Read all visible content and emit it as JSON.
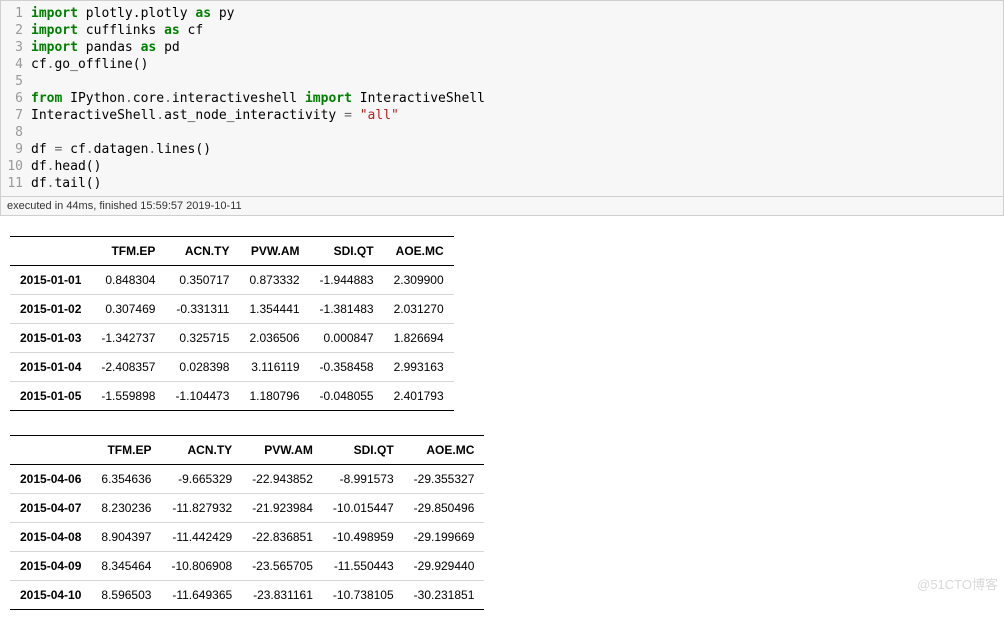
{
  "code": {
    "lines": [
      {
        "n": "1",
        "tokens": [
          [
            "kw",
            "import"
          ],
          [
            "nm",
            " plotly.plotly "
          ],
          [
            "kw",
            "as"
          ],
          [
            "nm",
            " py"
          ]
        ]
      },
      {
        "n": "2",
        "tokens": [
          [
            "kw",
            "import"
          ],
          [
            "nm",
            " cufflinks "
          ],
          [
            "kw",
            "as"
          ],
          [
            "nm",
            " cf"
          ]
        ]
      },
      {
        "n": "3",
        "tokens": [
          [
            "kw",
            "import"
          ],
          [
            "nm",
            " pandas "
          ],
          [
            "kw",
            "as"
          ],
          [
            "nm",
            " pd"
          ]
        ]
      },
      {
        "n": "4",
        "tokens": [
          [
            "nm",
            "cf"
          ],
          [
            "op",
            "."
          ],
          [
            "nm",
            "go_offline()"
          ]
        ]
      },
      {
        "n": "5",
        "tokens": [
          [
            "nm",
            ""
          ]
        ]
      },
      {
        "n": "6",
        "tokens": [
          [
            "kw",
            "from"
          ],
          [
            "nm",
            " IPython"
          ],
          [
            "op",
            "."
          ],
          [
            "nm",
            "core"
          ],
          [
            "op",
            "."
          ],
          [
            "nm",
            "interactiveshell "
          ],
          [
            "kw",
            "import"
          ],
          [
            "nm",
            " InteractiveShell"
          ]
        ]
      },
      {
        "n": "7",
        "tokens": [
          [
            "nm",
            "InteractiveShell"
          ],
          [
            "op",
            "."
          ],
          [
            "nm",
            "ast_node_interactivity "
          ],
          [
            "op",
            "="
          ],
          [
            "nm",
            " "
          ],
          [
            "str",
            "\"all\""
          ]
        ]
      },
      {
        "n": "8",
        "tokens": [
          [
            "nm",
            ""
          ]
        ]
      },
      {
        "n": "9",
        "tokens": [
          [
            "nm",
            "df "
          ],
          [
            "op",
            "="
          ],
          [
            "nm",
            " cf"
          ],
          [
            "op",
            "."
          ],
          [
            "nm",
            "datagen"
          ],
          [
            "op",
            "."
          ],
          [
            "nm",
            "lines()"
          ]
        ]
      },
      {
        "n": "10",
        "tokens": [
          [
            "nm",
            "df"
          ],
          [
            "op",
            "."
          ],
          [
            "nm",
            "head()"
          ]
        ]
      },
      {
        "n": "11",
        "tokens": [
          [
            "nm",
            "df"
          ],
          [
            "op",
            "."
          ],
          [
            "nm",
            "tail()"
          ]
        ]
      }
    ]
  },
  "exec_info": "executed in 44ms, finished 15:59:57 2019-10-11",
  "tables": {
    "head": {
      "columns": [
        "TFM.EP",
        "ACN.TY",
        "PVW.AM",
        "SDI.QT",
        "AOE.MC"
      ],
      "rows": [
        {
          "idx": "2015-01-01",
          "vals": [
            "0.848304",
            "0.350717",
            "0.873332",
            "-1.944883",
            "2.309900"
          ]
        },
        {
          "idx": "2015-01-02",
          "vals": [
            "0.307469",
            "-0.331311",
            "1.354441",
            "-1.381483",
            "2.031270"
          ]
        },
        {
          "idx": "2015-01-03",
          "vals": [
            "-1.342737",
            "0.325715",
            "2.036506",
            "0.000847",
            "1.826694"
          ]
        },
        {
          "idx": "2015-01-04",
          "vals": [
            "-2.408357",
            "0.028398",
            "3.116119",
            "-0.358458",
            "2.993163"
          ]
        },
        {
          "idx": "2015-01-05",
          "vals": [
            "-1.559898",
            "-1.104473",
            "1.180796",
            "-0.048055",
            "2.401793"
          ]
        }
      ]
    },
    "tail": {
      "columns": [
        "TFM.EP",
        "ACN.TY",
        "PVW.AM",
        "SDI.QT",
        "AOE.MC"
      ],
      "rows": [
        {
          "idx": "2015-04-06",
          "vals": [
            "6.354636",
            "-9.665329",
            "-22.943852",
            "-8.991573",
            "-29.355327"
          ]
        },
        {
          "idx": "2015-04-07",
          "vals": [
            "8.230236",
            "-11.827932",
            "-21.923984",
            "-10.015447",
            "-29.850496"
          ]
        },
        {
          "idx": "2015-04-08",
          "vals": [
            "8.904397",
            "-11.442429",
            "-22.836851",
            "-10.498959",
            "-29.199669"
          ]
        },
        {
          "idx": "2015-04-09",
          "vals": [
            "8.345464",
            "-10.806908",
            "-23.565705",
            "-11.550443",
            "-29.929440"
          ]
        },
        {
          "idx": "2015-04-10",
          "vals": [
            "8.596503",
            "-11.649365",
            "-23.831161",
            "-10.738105",
            "-30.231851"
          ]
        }
      ]
    }
  },
  "watermark": "@51CTO博客"
}
